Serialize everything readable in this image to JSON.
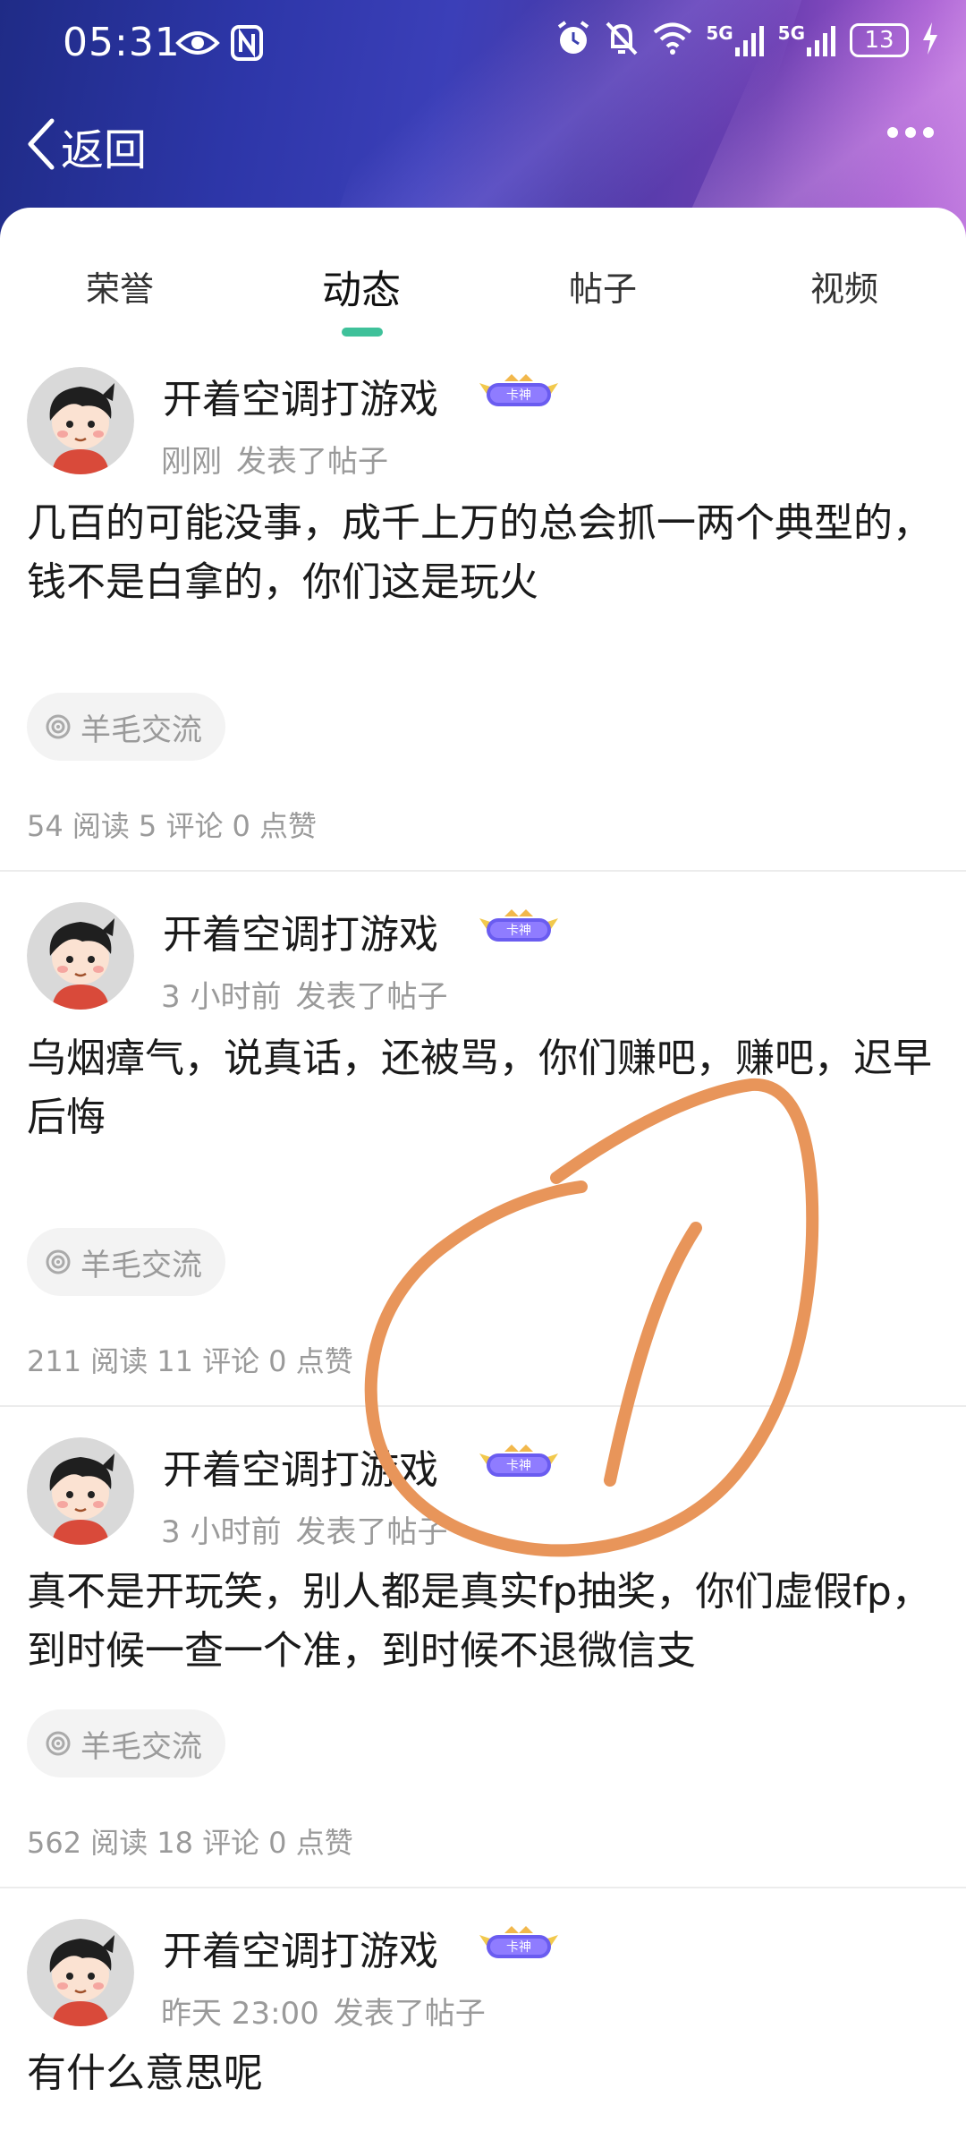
{
  "status_bar": {
    "time": "05:31",
    "battery": "13",
    "network_1": "5G",
    "network_2": "5G"
  },
  "nav": {
    "back_label": "返回"
  },
  "tabs": [
    {
      "label": "荣誉",
      "active": false
    },
    {
      "label": "动态",
      "active": true
    },
    {
      "label": "帖子",
      "active": false
    },
    {
      "label": "视频",
      "active": false
    }
  ],
  "posts": [
    {
      "username": "开着空调打游戏",
      "badge": "卡神",
      "time": "刚刚",
      "action": "发表了帖子",
      "content": "几百的可能没事，成千上万的总会抓一两个典型的，钱不是白拿的，你们这是玩火",
      "tag": "羊毛交流",
      "reads": "54 阅读",
      "comments": "5 评论",
      "likes": "0 点赞"
    },
    {
      "username": "开着空调打游戏",
      "badge": "卡神",
      "time": "3 小时前",
      "action": "发表了帖子",
      "content": "乌烟瘴气，说真话，还被骂，你们赚吧，赚吧，迟早后悔",
      "tag": "羊毛交流",
      "reads": "211 阅读",
      "comments": "11 评论",
      "likes": "0 点赞"
    },
    {
      "username": "开着空调打游戏",
      "badge": "卡神",
      "time": "3 小时前",
      "action": "发表了帖子",
      "content": "真不是开玩笑，别人都是真实fp抽奖，你们虚假fp，到时候一查一个准，到时候不退微信支",
      "tag": "羊毛交流",
      "reads": "562 阅读",
      "comments": "18 评论",
      "likes": "0 点赞"
    },
    {
      "username": "开着空调打游戏",
      "badge": "卡神",
      "time": "昨天 23:00",
      "action": "发表了帖子",
      "content": "有什么意思呢"
    }
  ],
  "colors": {
    "accent": "#3fc19a",
    "annotation_stroke": "#e8955a"
  },
  "icons": {
    "back": "chevron-left-icon",
    "more": "more-dots-icon",
    "tag": "target-icon"
  }
}
